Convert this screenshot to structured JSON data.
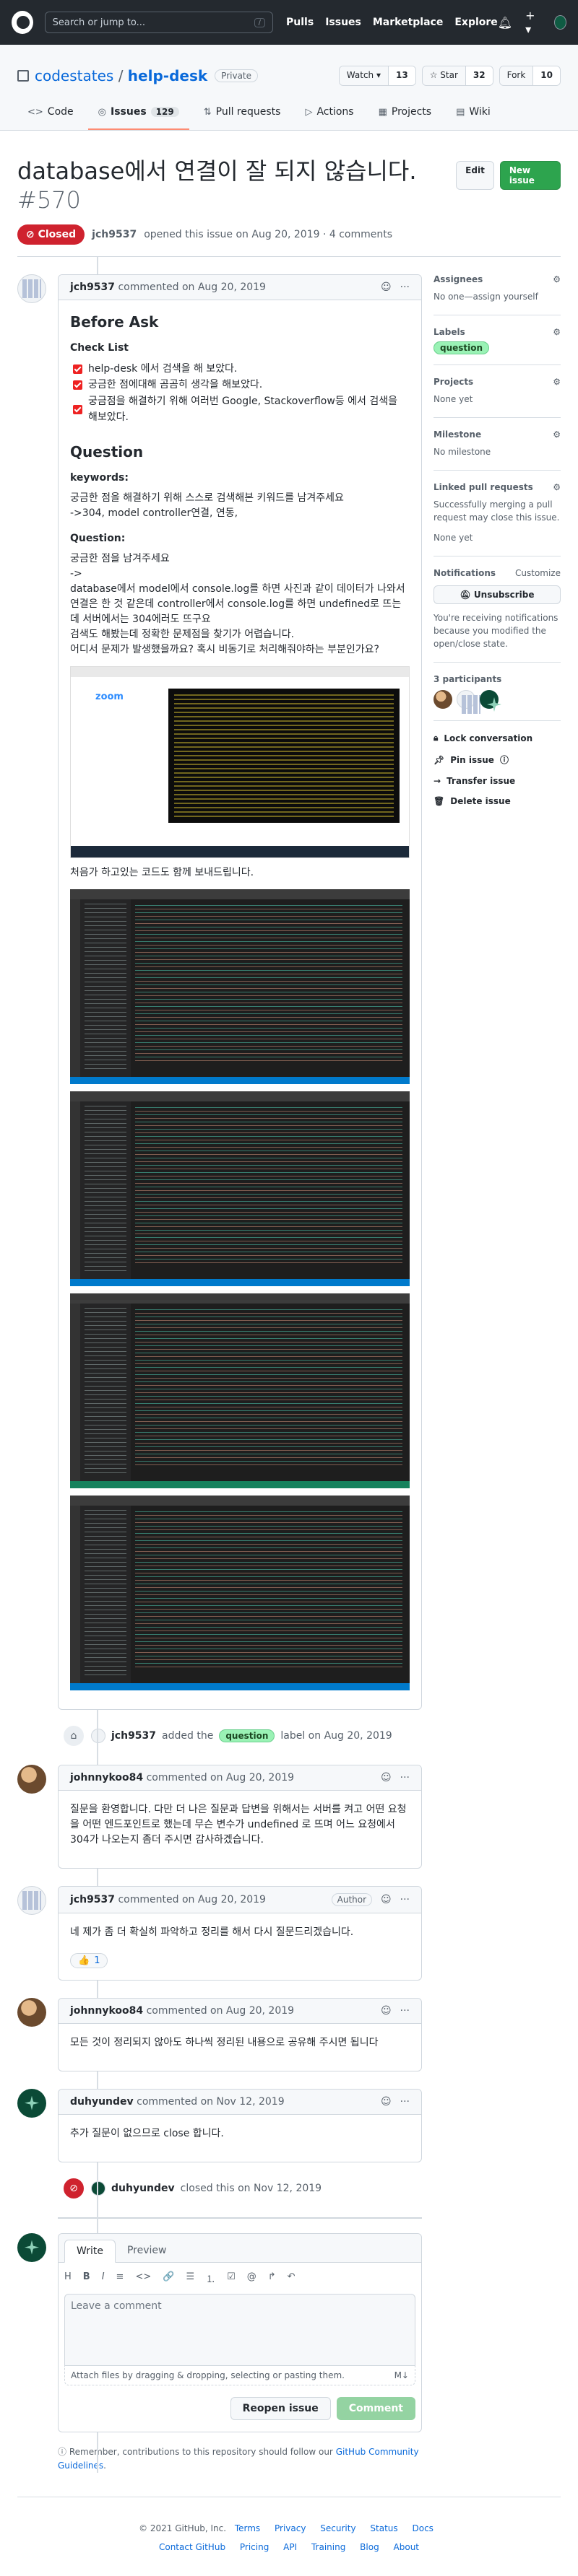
{
  "header": {
    "search_placeholder": "Search or jump to...",
    "slash": "/",
    "nav": [
      "Pulls",
      "Issues",
      "Marketplace",
      "Explore"
    ],
    "bell_icon": "bell-icon",
    "plus_icon": "plus-icon"
  },
  "repo": {
    "owner": "codestates",
    "separator": "/",
    "name": "help-desk",
    "visibility": "Private",
    "watch_label": "Watch ▾",
    "watch_count": "13",
    "star_label": "☆ Star",
    "star_count": "32",
    "fork_label": "Fork",
    "fork_count": "10",
    "tabs": [
      {
        "label": "Code",
        "icon": "<>"
      },
      {
        "label": "Issues",
        "count": "129",
        "icon": "◎"
      },
      {
        "label": "Pull requests",
        "icon": "⇅"
      },
      {
        "label": "Actions",
        "icon": "▷"
      },
      {
        "label": "Projects",
        "icon": "▦"
      },
      {
        "label": "Wiki",
        "icon": "▤"
      }
    ]
  },
  "issue": {
    "title": "database에서 연결이 잘 되지 않습니다.",
    "number": "#570",
    "edit_label": "Edit",
    "new_issue_label": "New issue",
    "state": "Closed",
    "author": "jch9537",
    "opened_text": "opened this issue on Aug 20, 2019 · 4 comments"
  },
  "comments": [
    {
      "author": "jch9537",
      "meta": "commented on Aug 20, 2019",
      "body": {
        "h_before": "Before Ask",
        "h_checklist": "Check List",
        "checklist": [
          "help-desk 에서 검색을 해 보았다.",
          "궁금한 점에대해 곰곰히 생각을 해보았다.",
          "궁금점을 해결하기 위해 여러번 Google, Stackoverflow등 에서 검색을 해보았다."
        ],
        "h_question": "Question",
        "h_keywords": "keywords:",
        "keywords_text": "궁금한 점을 해결하기 위해 스스로 검색해본 키워드를 남겨주세요",
        "keywords_value": "->304, model controller연결, 연동,",
        "h_question2": "Question:",
        "q_line1": "궁금한 점을 남겨주세요",
        "q_line2": "->",
        "q_line3": "database에서 model에서 console.log를 하면 사진과 같이 데이터가 나와서 연결은 한 것 같은데 controller에서 console.log를 하면 undefined로 뜨는데 서버에서는 304에러도 뜨구요",
        "q_line4": "검색도 해봤는데 정확한 문제점을 찾기가 어렵습니다.",
        "q_line5": "어디서 문제가 발생했을까요? 혹시 비동기로 처리해줘야하는 부분인가요?",
        "zoom_text": "zoom",
        "code_caption": "처음가 하고있는 코드도 함께 보내드립니다."
      }
    },
    {
      "author": "johnnykoo84",
      "meta": "commented on Aug 20, 2019",
      "body_text": "질문을 환영합니다. 다만 더 나은 질문과 답변을 위해서는 서버를 켜고 어떤 요청을 어떤 엔드포인트로 했는데 무슨 변수가 undefined 로 뜨며 어느 요청에서 304가 나오는지 좀더 주시면 감사하겠습니다."
    },
    {
      "author": "jch9537",
      "meta": "commented on Aug 20, 2019",
      "role": "Author",
      "body_text": "네 제가 좀 더 확실히 파악하고 정리를 해서 다시 질문드리겠습니다.",
      "reaction_emoji": "👍",
      "reaction_count": "1"
    },
    {
      "author": "johnnykoo84",
      "meta": "commented on Aug 20, 2019",
      "body_text": "모든 것이 정리되지 않아도 하나씩 정리된 내용으로 공유해 주시면 됩니다"
    },
    {
      "author": "duhyundev",
      "meta": "commented on Nov 12, 2019",
      "body_text": "추가 질문이 없으므로 close 합니다."
    }
  ],
  "events": {
    "label_actor": "jch9537",
    "label_added": "added the",
    "label_name": "question",
    "label_suffix": "label on Aug 20, 2019",
    "closed_actor": "duhyundev",
    "closed_text": "closed this on Nov 12, 2019"
  },
  "editor": {
    "tab_write": "Write",
    "tab_preview": "Preview",
    "toolbar": [
      "H",
      "B",
      "I",
      "≡",
      "<>",
      "🔗",
      "☰",
      "⒈",
      "☑",
      "@",
      "↱",
      "↶"
    ],
    "placeholder": "Leave a comment",
    "attach_text": "Attach files by dragging & dropping, selecting or pasting them.",
    "md_badge": "M↓",
    "reopen_label": "Reopen issue",
    "comment_label": "Comment",
    "remember_pre": "Remember, contributions to this repository should follow our",
    "remember_link": "GitHub Community Guidelines",
    "remember_post": "."
  },
  "sidebar": {
    "assignees_h": "Assignees",
    "assignees_v": "No one—assign yourself",
    "labels_h": "Labels",
    "labels_v": "question",
    "projects_h": "Projects",
    "projects_v": "None yet",
    "milestone_h": "Milestone",
    "milestone_v": "No milestone",
    "linked_h": "Linked pull requests",
    "linked_desc": "Successfully merging a pull request may close this issue.",
    "linked_v": "None yet",
    "notif_h": "Notifications",
    "notif_customize": "Customize",
    "unsubscribe": "Unsubscribe",
    "notif_desc": "You're receiving notifications because you modified the open/close state.",
    "participants": "3 participants",
    "lock": "Lock conversation",
    "pin": "Pin issue",
    "transfer": "Transfer issue",
    "delete": "Delete issue"
  },
  "footer": {
    "copyright": "© 2021 GitHub, Inc.",
    "links1": [
      "Terms",
      "Privacy",
      "Security",
      "Status",
      "Docs"
    ],
    "links2": [
      "Contact GitHub",
      "Pricing",
      "API",
      "Training",
      "Blog",
      "About"
    ]
  }
}
